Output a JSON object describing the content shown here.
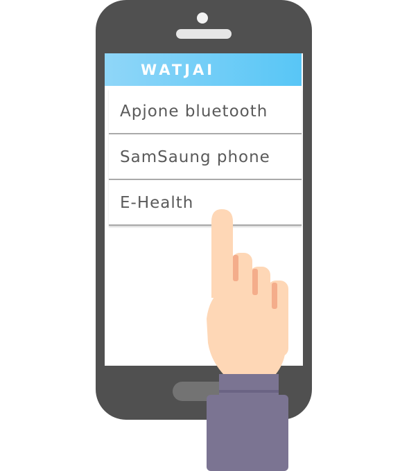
{
  "app": {
    "title": "WATJAI"
  },
  "menu": {
    "items": [
      {
        "label": "Apjone bluetooth"
      },
      {
        "label": "SamSaung phone"
      },
      {
        "label": "E-Health"
      }
    ]
  },
  "colors": {
    "phone_body": "#505050",
    "header_gradient_start": "#8fd6f8",
    "header_gradient_end": "#58c6f6",
    "hand_skin": "#fed7b6",
    "finger_crease": "#f4ad8b",
    "sleeve": "#7b7492"
  },
  "icons": {
    "pointer": "pointing-hand-icon"
  }
}
